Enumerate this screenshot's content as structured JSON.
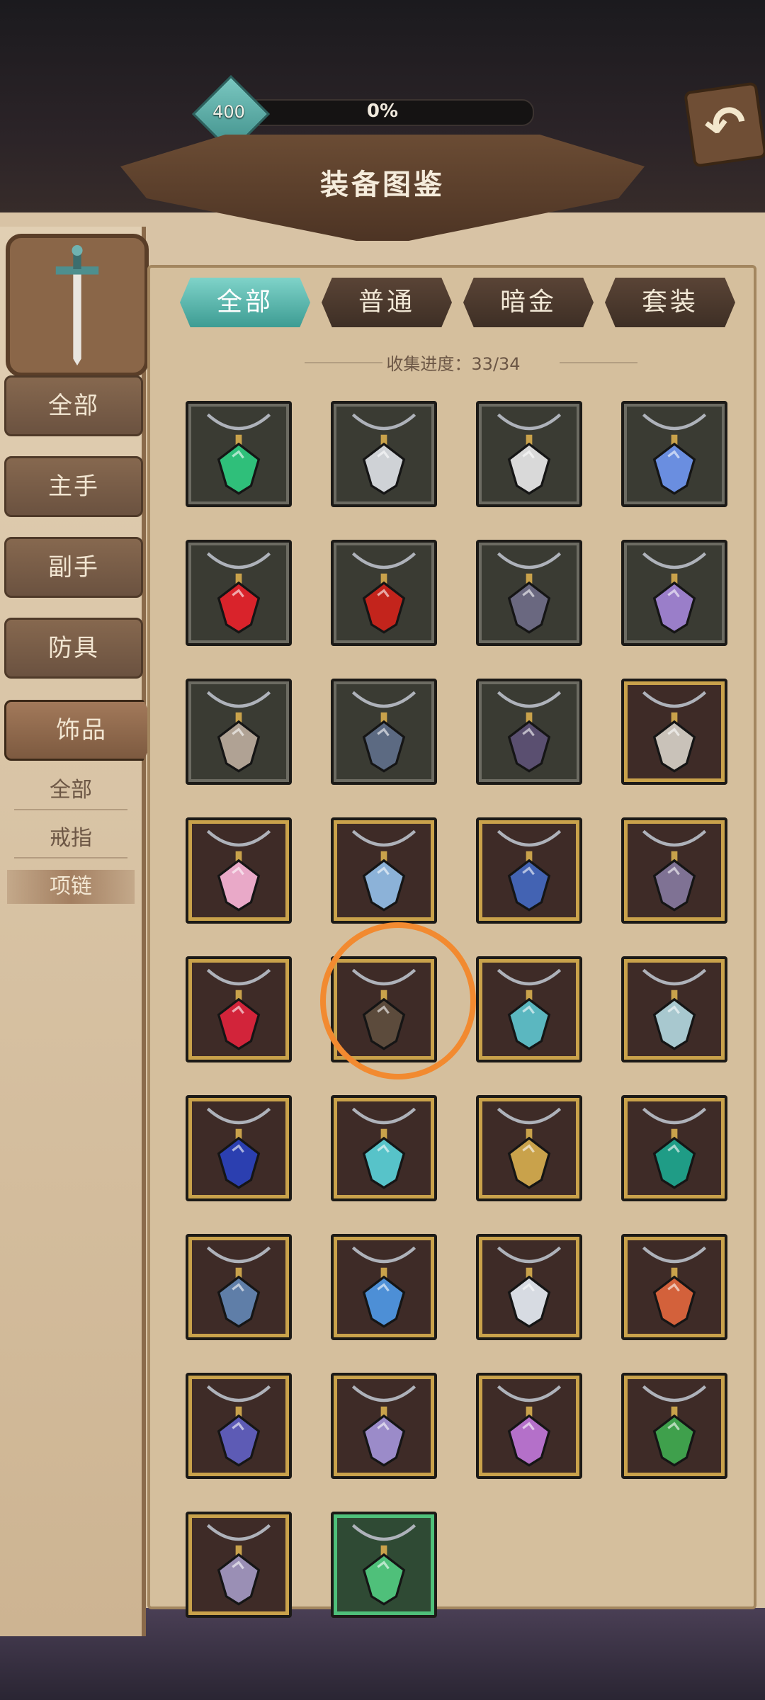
{
  "header": {
    "level": "400",
    "progress_percent": "0%",
    "progress_value": 0,
    "title": "装备图鉴",
    "back_label": "↶"
  },
  "sidebar": {
    "categories": [
      {
        "label": "全部",
        "active": false
      },
      {
        "label": "主手",
        "active": false
      },
      {
        "label": "副手",
        "active": false
      },
      {
        "label": "防具",
        "active": false
      },
      {
        "label": "饰品",
        "active": true
      }
    ],
    "subcategories": [
      {
        "label": "全部",
        "active": false
      },
      {
        "label": "戒指",
        "active": false
      },
      {
        "label": "项链",
        "active": true
      }
    ]
  },
  "tabs": [
    {
      "label": "全部",
      "active": true
    },
    {
      "label": "普通",
      "active": false
    },
    {
      "label": "暗金",
      "active": false
    },
    {
      "label": "套装",
      "active": false
    }
  ],
  "collection": {
    "label": "收集进度：33/34"
  },
  "items": [
    {
      "frame": "plain",
      "icon": "green-gem-necklace-icon",
      "color": "#2fbf7a"
    },
    {
      "frame": "plain",
      "icon": "silver-cross-necklace-icon",
      "color": "#cfd2d6"
    },
    {
      "frame": "plain",
      "icon": "shield-pendant-icon",
      "color": "#d9d9d9"
    },
    {
      "frame": "plain",
      "icon": "blue-crystal-cage-icon",
      "color": "#6a8ee0"
    },
    {
      "frame": "plain",
      "icon": "red-heart-gem-icon",
      "color": "#d9232b"
    },
    {
      "frame": "plain",
      "icon": "red-oval-gem-icon",
      "color": "#c3241c"
    },
    {
      "frame": "plain",
      "icon": "dark-crystal-shard-icon",
      "color": "#6a6880"
    },
    {
      "frame": "plain",
      "icon": "purple-crystal-icon",
      "color": "#9a7ec9"
    },
    {
      "frame": "plain",
      "icon": "horn-pendant-icon",
      "color": "#b0a294"
    },
    {
      "frame": "plain",
      "icon": "stone-rune-pendant-icon",
      "color": "#5c6a82"
    },
    {
      "frame": "plain",
      "icon": "bat-wing-pendant-icon",
      "color": "#5a4f70"
    },
    {
      "frame": "gold",
      "icon": "coffin-tablet-icon",
      "color": "#c9c2b9"
    },
    {
      "frame": "gold",
      "icon": "pink-flame-pendant-icon",
      "color": "#e9a9c8"
    },
    {
      "frame": "gold",
      "icon": "ice-dagger-pendant-icon",
      "color": "#8cb2d8"
    },
    {
      "frame": "gold",
      "icon": "orb-talisman-icon",
      "color": "#4363b3"
    },
    {
      "frame": "gold",
      "icon": "purple-shard-icon",
      "color": "#7f7294"
    },
    {
      "frame": "gold",
      "icon": "red-ruby-wrap-icon",
      "color": "#d2243a"
    },
    {
      "frame": "gold",
      "icon": "dark-shield-pendant-icon",
      "color": "#5c4b3c"
    },
    {
      "frame": "gold",
      "icon": "teal-disk-pendant-icon",
      "color": "#5bb7c0"
    },
    {
      "frame": "gold",
      "icon": "teal-ring-pendant-icon",
      "color": "#a8c8cf"
    },
    {
      "frame": "gold",
      "icon": "blue-heart-pendant-icon",
      "color": "#2b3fb0"
    },
    {
      "frame": "gold",
      "icon": "crescent-moon-pendant-icon",
      "color": "#57c3c9"
    },
    {
      "frame": "gold",
      "icon": "golden-lion-pendant-icon",
      "color": "#c9a24b"
    },
    {
      "frame": "gold",
      "icon": "emerald-orb-pendant-icon",
      "color": "#1f9c86"
    },
    {
      "frame": "gold",
      "icon": "serpent-pendant-icon",
      "color": "#5f7ea8"
    },
    {
      "frame": "gold",
      "icon": "eye-amulet-icon",
      "color": "#4d8fd6"
    },
    {
      "frame": "gold",
      "icon": "lightning-pendant-icon",
      "color": "#d7dbe2"
    },
    {
      "frame": "gold",
      "icon": "red-star-pendant-icon",
      "color": "#d3613b"
    },
    {
      "frame": "gold",
      "icon": "caged-violet-orb-icon",
      "color": "#5d5bb5"
    },
    {
      "frame": "gold",
      "icon": "spirit-crystal-pendant-icon",
      "color": "#9b8bc9"
    },
    {
      "frame": "gold",
      "icon": "chained-skull-pendant-icon",
      "color": "#b470c9"
    },
    {
      "frame": "gold",
      "icon": "green-vial-pendant-icon",
      "color": "#3fa04c"
    },
    {
      "frame": "gold",
      "icon": "ghost-skull-pendant-icon",
      "color": "#9a8fb5"
    },
    {
      "frame": "green",
      "icon": "emerald-gem-cluster-icon",
      "color": "#4fc07a"
    }
  ]
}
